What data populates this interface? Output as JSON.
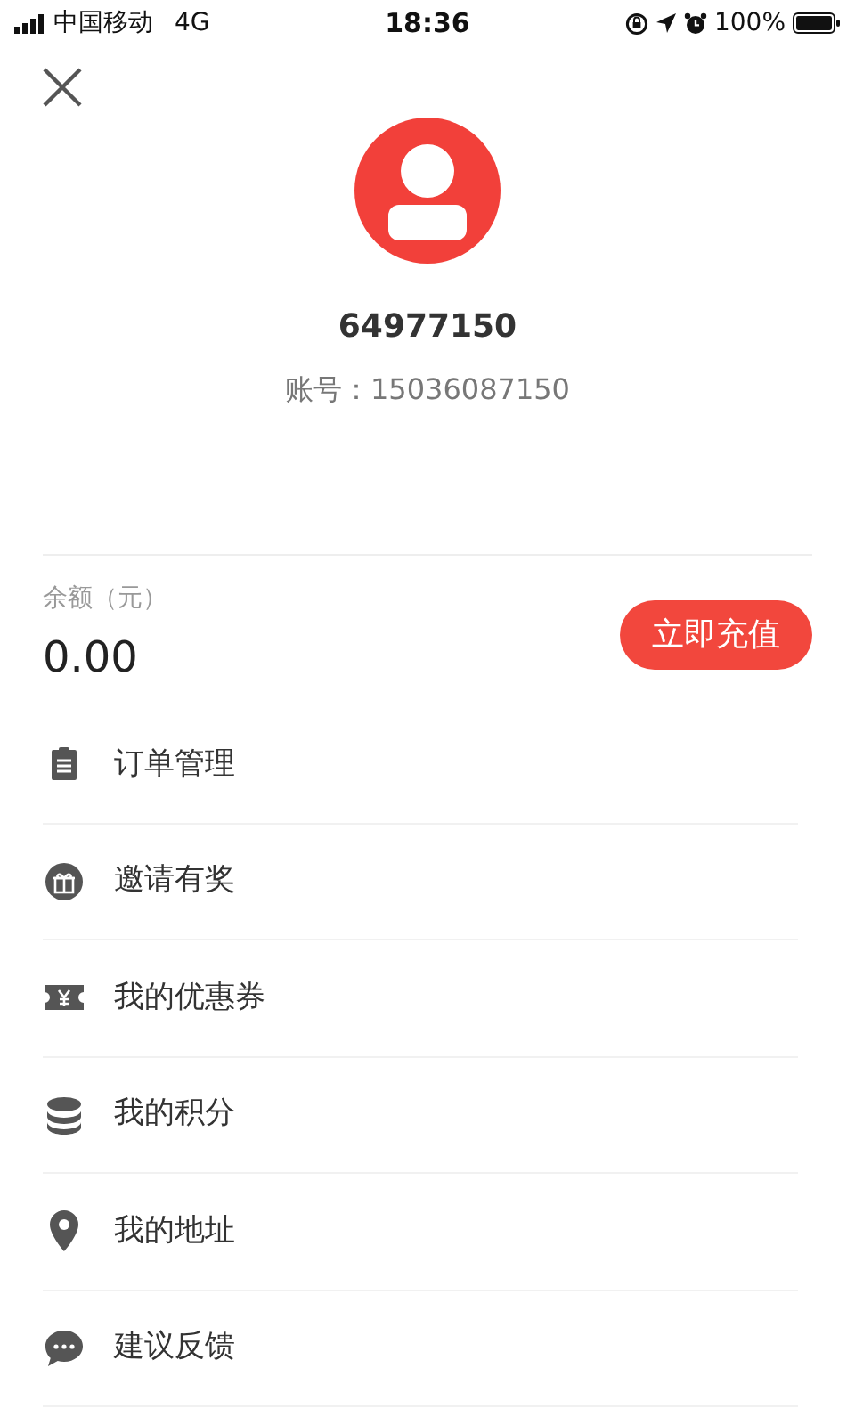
{
  "status_bar": {
    "carrier": "中国移动",
    "network": "4G",
    "time": "18:36",
    "battery": "100%"
  },
  "profile": {
    "name": "64977150",
    "account_label": "账号：",
    "account": "15036087150"
  },
  "balance": {
    "label": "余额（元）",
    "value": "0.00",
    "button": "立即充值"
  },
  "menu": [
    {
      "label": "订单管理"
    },
    {
      "label": "邀请有奖"
    },
    {
      "label": "我的优惠券"
    },
    {
      "label": "我的积分"
    },
    {
      "label": "我的地址"
    },
    {
      "label": "建议反馈"
    }
  ]
}
